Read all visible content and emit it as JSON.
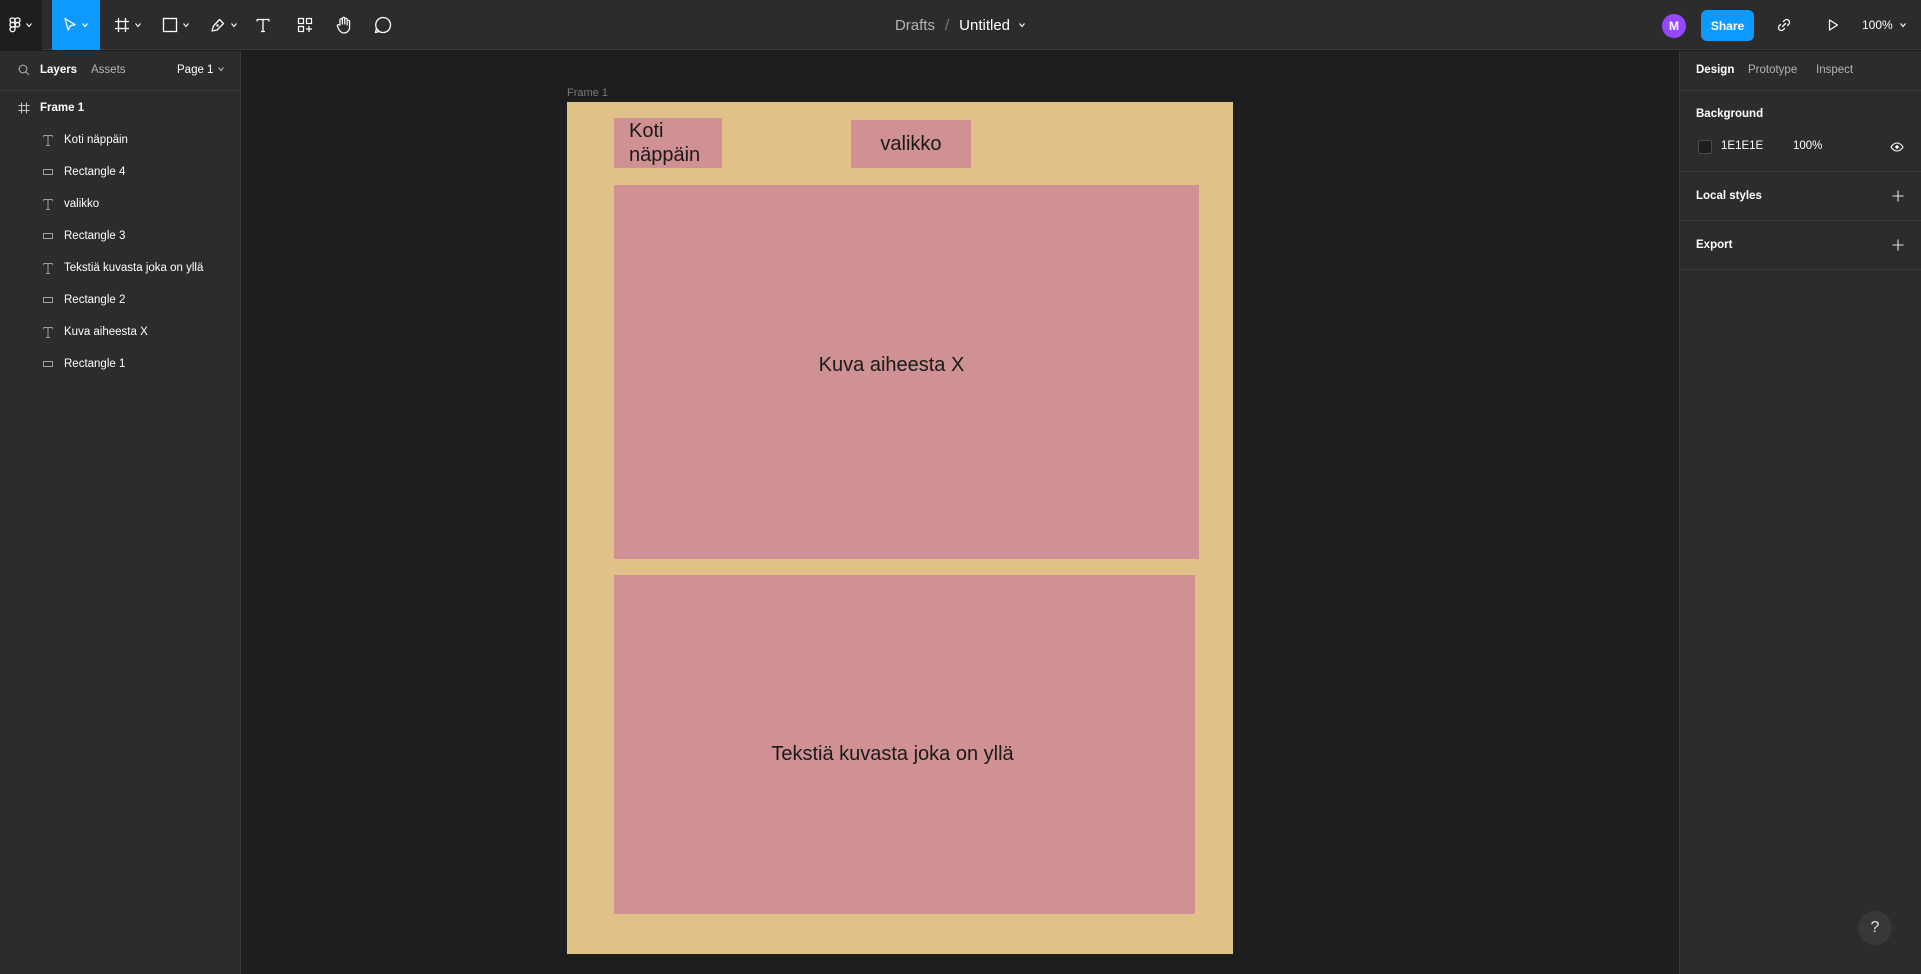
{
  "toolbar": {
    "breadcrumb": "Drafts",
    "separator": "/",
    "file_name": "Untitled",
    "avatar_initial": "M",
    "share_label": "Share",
    "zoom_level": "100%",
    "tools": [
      "main-menu",
      "move",
      "frame",
      "shape",
      "pen",
      "text",
      "resources",
      "hand",
      "comment"
    ]
  },
  "left_panel": {
    "tabs": [
      "Layers",
      "Assets"
    ],
    "page_selector": "Page 1",
    "layers": [
      {
        "name": "Frame 1",
        "type": "frame"
      },
      {
        "name": "Koti näppäin",
        "type": "text"
      },
      {
        "name": "Rectangle 4",
        "type": "rectangle"
      },
      {
        "name": "valikko",
        "type": "text"
      },
      {
        "name": "Rectangle 3",
        "type": "rectangle"
      },
      {
        "name": "Tekstiä kuvasta joka on yllä",
        "type": "text"
      },
      {
        "name": "Rectangle 2",
        "type": "rectangle"
      },
      {
        "name": "Kuva aiheesta X",
        "type": "text"
      },
      {
        "name": "Rectangle 1",
        "type": "rectangle"
      }
    ]
  },
  "canvas": {
    "frame_label": "Frame 1",
    "frame_fill": "#e0c187",
    "rect_fill": "#cf9193",
    "koti_line1": "Koti",
    "koti_line2": "näppäin",
    "valikko": "valikko",
    "image_text": "Kuva aiheesta X",
    "body_text": "Tekstiä kuvasta joka on yllä"
  },
  "right_panel": {
    "tabs": [
      "Design",
      "Prototype",
      "Inspect"
    ],
    "background_heading": "Background",
    "background_hex": "1E1E1E",
    "background_opacity": "100%",
    "local_styles": "Local styles",
    "export": "Export"
  },
  "help_label": "?",
  "colors": {
    "accent": "#0d99ff",
    "avatar": "#9747ff",
    "panel": "#2c2c2c",
    "canvas": "#1e1e1e"
  }
}
